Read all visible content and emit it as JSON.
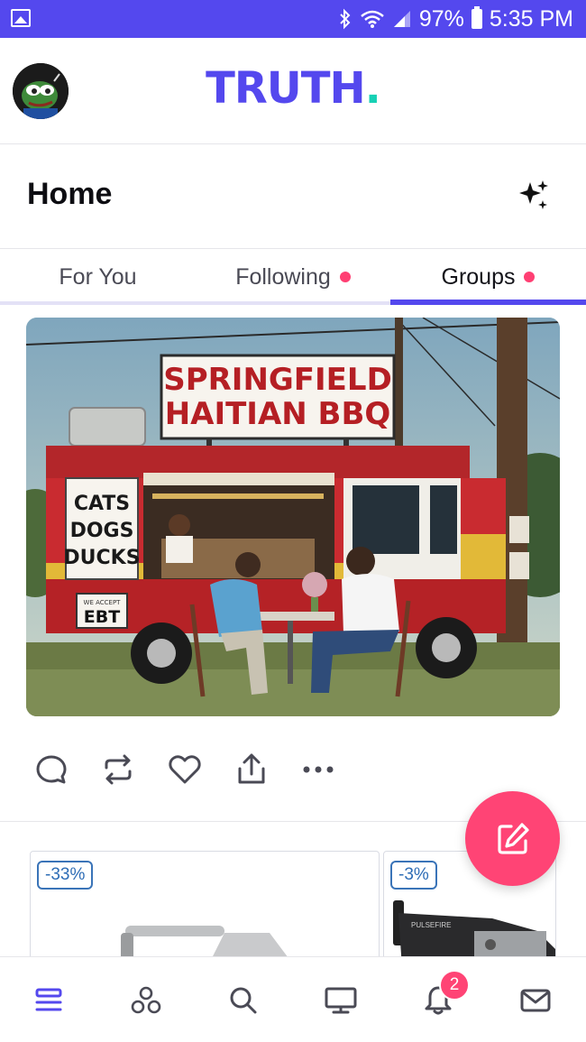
{
  "status_bar": {
    "battery": "97%",
    "time": "5:35 PM",
    "icons": [
      "gallery-icon",
      "bluetooth-icon",
      "wifi-icon",
      "signal-icon",
      "battery-icon"
    ]
  },
  "header": {
    "logo_text": "TRUTH",
    "logo_dot": ".",
    "brand_color": "#5448ee",
    "logo_dot_color": "#17d1b5"
  },
  "page": {
    "title": "Home",
    "action_icon": "sparkles-icon"
  },
  "tabs": [
    {
      "label": "For You",
      "has_dot": false,
      "active": false
    },
    {
      "label": "Following",
      "has_dot": true,
      "active": false
    },
    {
      "label": "Groups",
      "has_dot": true,
      "active": true
    }
  ],
  "post": {
    "image_sign_text": [
      "SPRINGFIELD",
      "HAITIAN BBQ"
    ],
    "image_menu_text": [
      "CATS",
      "DOGS",
      "DUCKS"
    ],
    "image_ebt_small": "WE ACCEPT",
    "image_ebt_text": "EBT",
    "actions": [
      "reply-icon",
      "repost-icon",
      "like-icon",
      "share-icon",
      "more-icon"
    ]
  },
  "ads": [
    {
      "discount": "-33%"
    },
    {
      "discount": "-3%",
      "product_text": "PULSEFIRE"
    }
  ],
  "fab": {
    "icon": "compose-icon",
    "color": "#ff4475"
  },
  "bottom_nav": {
    "items": [
      "feed-icon",
      "groups-icon",
      "search-icon",
      "tv-icon",
      "notifications-icon",
      "messages-icon"
    ],
    "notification_count": "2",
    "active_color": "#5448ee"
  }
}
